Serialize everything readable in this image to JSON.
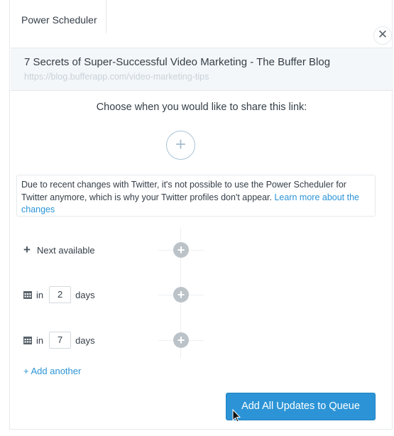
{
  "tab": {
    "label": "Power Scheduler"
  },
  "close": {
    "glyph": "✕"
  },
  "link": {
    "title": "7 Secrets of Super-Successful Video Marketing - The Buffer Blog",
    "url": "https://blog.bufferapp.com/video-marketing-tips"
  },
  "prompt": "Choose when you would like to share this link:",
  "add_time_glyph": "+",
  "notice": {
    "text": "Due to recent changes with Twitter, it's not possible to use the Power Scheduler for Twitter anymore, which is why your Twitter profiles don't appear. ",
    "link_text": "Learn more about the changes"
  },
  "slots": {
    "next_available": {
      "icon": "plus-icon",
      "label": "Next available"
    },
    "slot1": {
      "icon": "calendar-icon",
      "prefix": "in",
      "value": "2",
      "suffix": "days"
    },
    "slot2": {
      "icon": "calendar-icon",
      "prefix": "in",
      "value": "7",
      "suffix": "days"
    }
  },
  "add_another": "+ Add another",
  "queue_button": "Add All Updates to Queue",
  "colors": {
    "accent": "#2c94d6",
    "link_bg": "#f4f7f9",
    "muted": "#c8d2da"
  }
}
